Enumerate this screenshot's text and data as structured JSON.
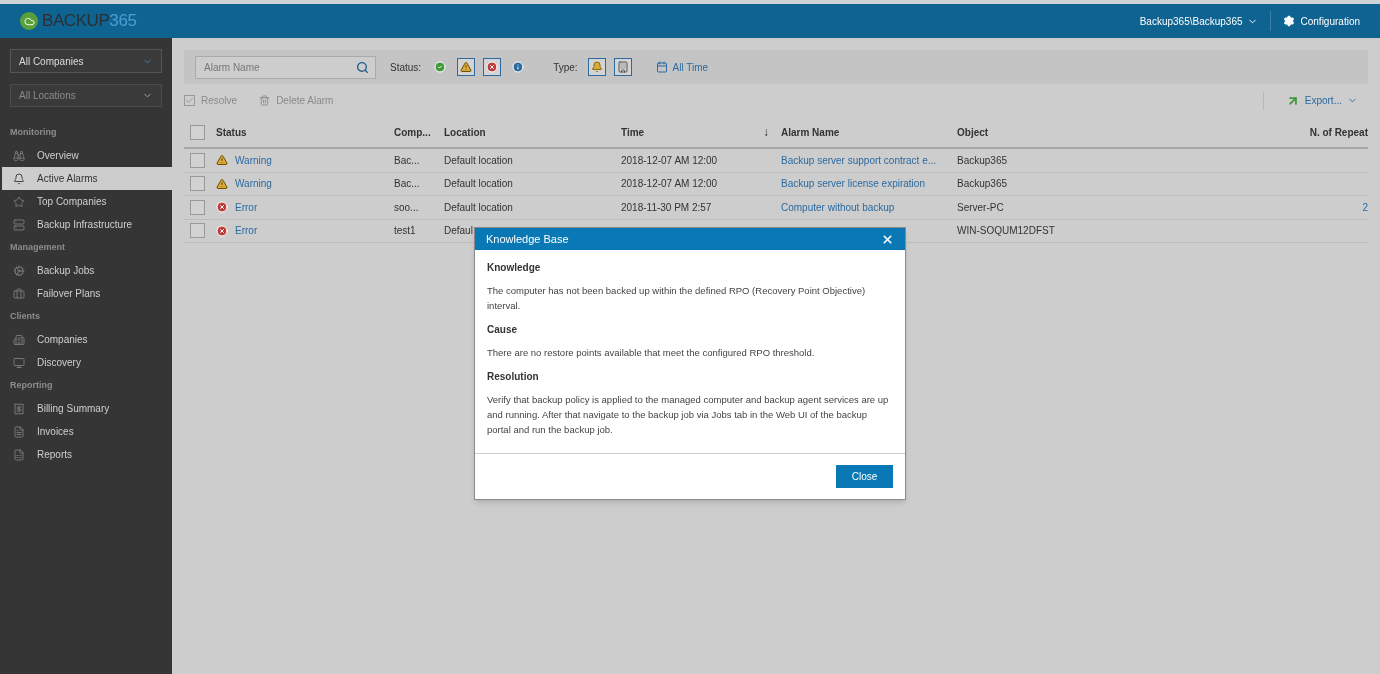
{
  "header": {
    "brand": "BACKUP",
    "brand_suffix": "365",
    "user_menu": "Backup365\\Backup365",
    "configuration": "Configuration"
  },
  "sidebar": {
    "company_select": {
      "value": "All Companies"
    },
    "location_select": {
      "placeholder": "All Locations",
      "disabled": true
    },
    "sections": [
      {
        "title": "Monitoring",
        "items": [
          {
            "label": "Overview",
            "selected": false
          },
          {
            "label": "Active Alarms",
            "selected": true
          },
          {
            "label": "Top Companies",
            "selected": false
          },
          {
            "label": "Backup Infrastructure",
            "selected": false
          }
        ]
      },
      {
        "title": "Management",
        "items": [
          {
            "label": "Backup Jobs",
            "selected": false
          },
          {
            "label": "Failover Plans",
            "selected": false
          }
        ]
      },
      {
        "title": "Clients",
        "items": [
          {
            "label": "Companies",
            "selected": false
          },
          {
            "label": "Discovery",
            "selected": false
          }
        ]
      },
      {
        "title": "Reporting",
        "items": [
          {
            "label": "Billing Summary",
            "selected": false
          },
          {
            "label": "Invoices",
            "selected": false
          },
          {
            "label": "Reports",
            "selected": false
          }
        ]
      }
    ]
  },
  "filters": {
    "search": {
      "placeholder": "Alarm Name"
    },
    "status_label": "Status:",
    "status_filters": [
      {
        "kind": "success",
        "selected": false
      },
      {
        "kind": "warning",
        "selected": true
      },
      {
        "kind": "error",
        "selected": true
      },
      {
        "kind": "info",
        "selected": false
      }
    ],
    "type_label": "Type:",
    "type_filters": [
      {
        "kind": "alarm",
        "selected": true
      },
      {
        "kind": "company",
        "selected": true
      }
    ],
    "period": "All Time"
  },
  "actions": [
    {
      "label": "Resolve",
      "disabled": true
    },
    {
      "label": "Delete Alarm",
      "disabled": true
    }
  ],
  "export": "Export...",
  "table": {
    "select_all": {
      "checked": false
    },
    "columns": [
      {
        "label": "Status"
      },
      {
        "label": "Comp..."
      },
      {
        "label": "Location"
      },
      {
        "label": "Time",
        "sort_indicator": "↓"
      },
      {
        "label": "Alarm Name"
      },
      {
        "label": "Object"
      },
      {
        "label": "N. of Repeat"
      }
    ],
    "rows": [
      {
        "checked": false,
        "status": {
          "kind": "warning",
          "label": "Warning"
        },
        "company": "Bac...",
        "location": "Default location",
        "time": "2018-12-07 AM 12:00",
        "alarm_name": "Backup server support contract e...",
        "object": "Backup365"
      },
      {
        "checked": false,
        "status": {
          "kind": "warning",
          "label": "Warning"
        },
        "company": "Bac...",
        "location": "Default location",
        "time": "2018-12-07 AM 12:00",
        "alarm_name": "Backup server license expiration",
        "object": "Backup365"
      },
      {
        "checked": false,
        "status": {
          "kind": "error",
          "label": "Error"
        },
        "company": "soo...",
        "location": "Default location",
        "time": "2018-11-30 PM 2:57",
        "alarm_name": "Computer without backup",
        "object": "Server-PC",
        "repeats": "2"
      },
      {
        "checked": false,
        "status": {
          "kind": "error",
          "label": "Error"
        },
        "company": "test1",
        "location": "Defaul",
        "object": "WIN-SOQUM12DFST"
      }
    ]
  },
  "dialog": {
    "title": "Knowledge Base",
    "sections": [
      {
        "heading": "Knowledge",
        "text": "The computer has not been backed up within the defined RPO (Recovery Point Objective) interval."
      },
      {
        "heading": "Cause",
        "text": "There are no restore points available that meet the configured RPO threshold."
      },
      {
        "heading": "Resolution",
        "text": "Verify that backup policy is applied to the managed computer and backup agent services are up and running. After that navigate to the backup job via Jobs tab in the Web UI of the backup portal and run the backup job."
      }
    ],
    "close_button": "Close"
  }
}
